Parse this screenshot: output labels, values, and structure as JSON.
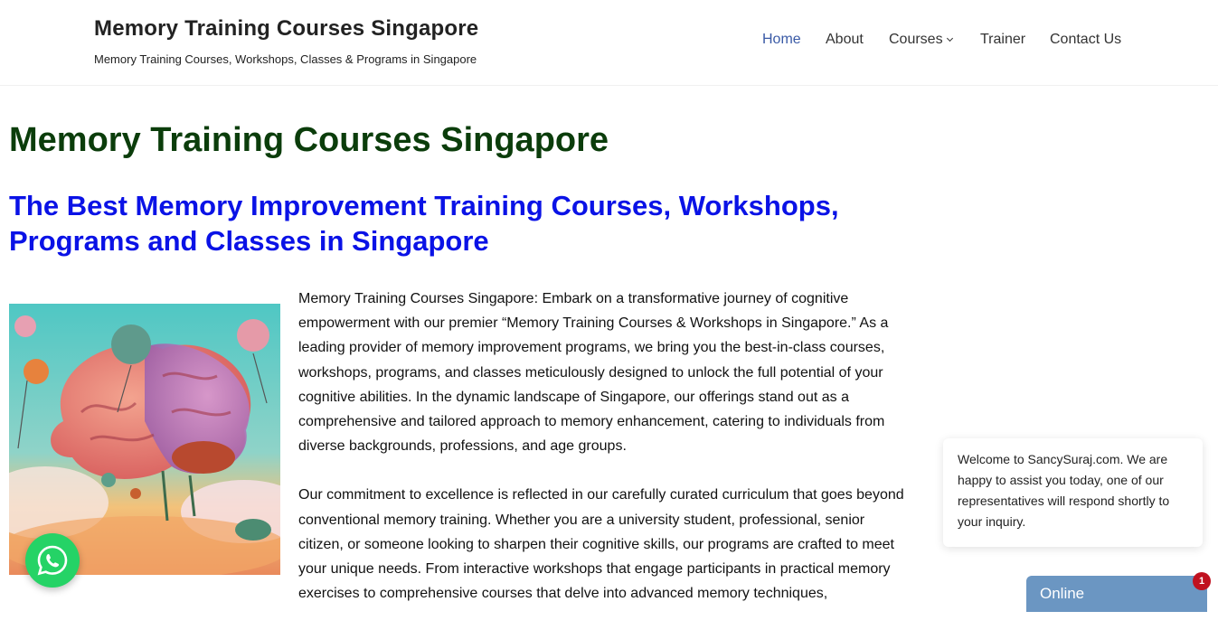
{
  "header": {
    "site_title": "Memory Training Courses Singapore",
    "tagline": "Memory Training Courses, Workshops, Classes & Programs in Singapore"
  },
  "nav": {
    "items": [
      {
        "label": "Home",
        "active": true
      },
      {
        "label": "About",
        "active": false
      },
      {
        "label": "Courses",
        "active": false,
        "has_dropdown": true
      },
      {
        "label": "Trainer",
        "active": false
      },
      {
        "label": "Contact Us",
        "active": false
      }
    ]
  },
  "main": {
    "title": "Memory Training Courses Singapore",
    "subtitle": "The Best Memory Improvement Training Courses, Workshops, Programs and Classes in Singapore",
    "image_icon": "brain-illustration",
    "paragraphs": [
      "Memory Training Courses Singapore: Embark on a transformative journey of cognitive empowerment with our premier “Memory Training Courses & Workshops in Singapore.” As a leading provider of memory improvement programs, we bring you the best-in-class courses, workshops, programs, and classes meticulously designed to unlock the full potential of your cognitive abilities. In the dynamic landscape of Singapore, our offerings stand out as a comprehensive and tailored approach to memory enhancement, catering to individuals from diverse backgrounds, professions, and age groups.",
      "Our commitment to excellence is reflected in our carefully curated curriculum that goes beyond conventional memory training. Whether you are a university student, professional, senior citizen, or someone looking to sharpen their cognitive skills, our programs are crafted to meet your unique needs. From interactive workshops that engage participants in practical memory exercises to comprehensive courses that delve into advanced memory techniques,"
    ]
  },
  "chat": {
    "message": "Welcome to SancySuraj.com. We are happy to assist you today, one of our representatives will respond shortly to your inquiry.",
    "status": "Online",
    "unread_count": "1",
    "tab_color": "#6b96c2",
    "badge_color": "#c0111f"
  },
  "whatsapp": {
    "icon": "whatsapp-icon",
    "color": "#25d366"
  },
  "colors": {
    "title_green": "#0b3d0b",
    "subtitle_blue": "#0a12e6",
    "nav_active": "#3a5aa6"
  }
}
